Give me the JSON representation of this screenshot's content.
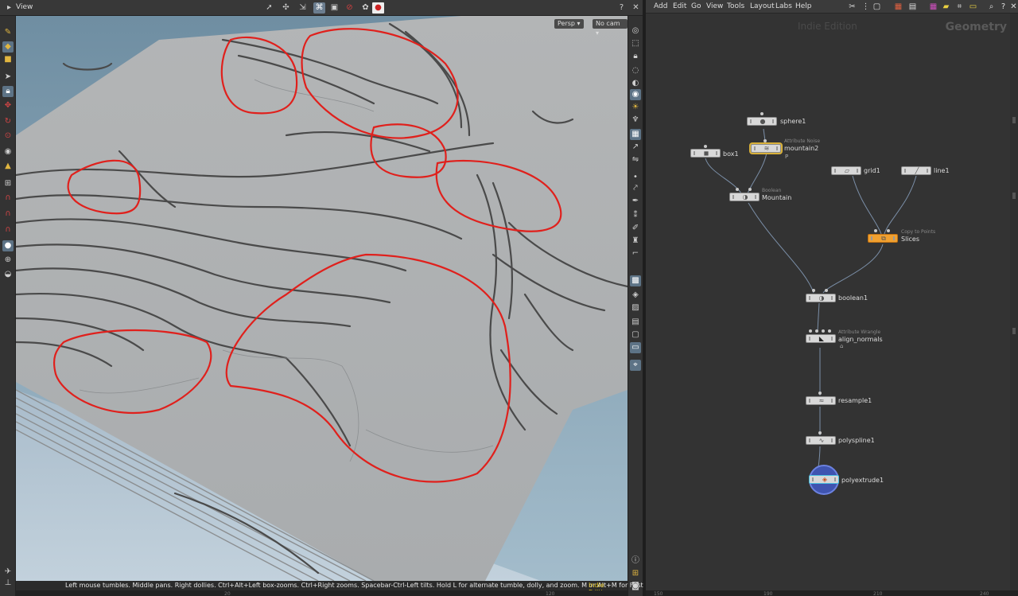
{
  "viewer": {
    "title": "View",
    "persp_label": "Persp",
    "cam_label": "No cam",
    "status_text": "Left mouse tumbles. Middle pans. Right dollies. Ctrl+Alt+Left box-zooms. Ctrl+Right zooms. Spacebar-Ctrl-Left tilts. Hold L for alternate tumble, dolly, and zoom.    M or Alt+M for First Person Navigation.",
    "edition": "Indie Edition",
    "ruler_ticks": [
      "20",
      "120"
    ]
  },
  "menus": [
    "Add",
    "Edit",
    "Go",
    "View",
    "Tools",
    "Layout",
    "Labs",
    "Help"
  ],
  "network": {
    "edition_watermark": "Indie Edition",
    "context_label": "Geometry",
    "nodes": {
      "sphere1": {
        "label": "sphere1",
        "sub": ""
      },
      "mountain2": {
        "label": "mountain2",
        "sub": "Attribute Noise",
        "flag": "P"
      },
      "box1": {
        "label": "box1",
        "sub": ""
      },
      "mountain": {
        "label": "Mountain",
        "sub": "Boolean"
      },
      "grid1": {
        "label": "grid1",
        "sub": ""
      },
      "line1": {
        "label": "line1",
        "sub": ""
      },
      "slices": {
        "label": "Slices",
        "sub": "Copy to Points"
      },
      "boolean1": {
        "label": "boolean1",
        "sub": ""
      },
      "align_normals": {
        "label": "align_normals",
        "sub": "Attribute Wrangle"
      },
      "resample1": {
        "label": "resample1",
        "sub": ""
      },
      "polyspline1": {
        "label": "polyspline1",
        "sub": ""
      },
      "polyextrude1": {
        "label": "polyextrude1",
        "sub": ""
      }
    },
    "ruler_ticks": [
      "150",
      "190",
      "210",
      "240"
    ]
  },
  "colors": {
    "annotation_red": "#e0201c",
    "node_orange": "#f0a030",
    "selection_gold": "#d9b13a",
    "display_ring_blue": "#3f54b0",
    "edition_yellow": "#e0c020",
    "sky": "#8aa6b8"
  },
  "icons": {
    "viewer_toolbar": [
      "select-icon",
      "move-icon",
      "handles-icon",
      "snap-icon",
      "display-options-icon",
      "no-entry-icon",
      "camera-icon",
      "record-icon",
      "help-icon",
      "close-icon"
    ],
    "left_shelf": [
      "paint-icon",
      "select-icon",
      "box-select-icon",
      "pointer-icon",
      "lock-icon",
      "magnet-icon",
      "camera-icon",
      "handle-icon"
    ],
    "right_shelf": [
      "eye-icon",
      "wireframe-icon",
      "lock-icon",
      "light-icon",
      "shading-icon",
      "display-icon"
    ],
    "menubar_tools": [
      "tools-icon",
      "grid-view-icon",
      "color-palette-icon",
      "sticky-note-icon",
      "search-icon",
      "help-icon"
    ]
  }
}
